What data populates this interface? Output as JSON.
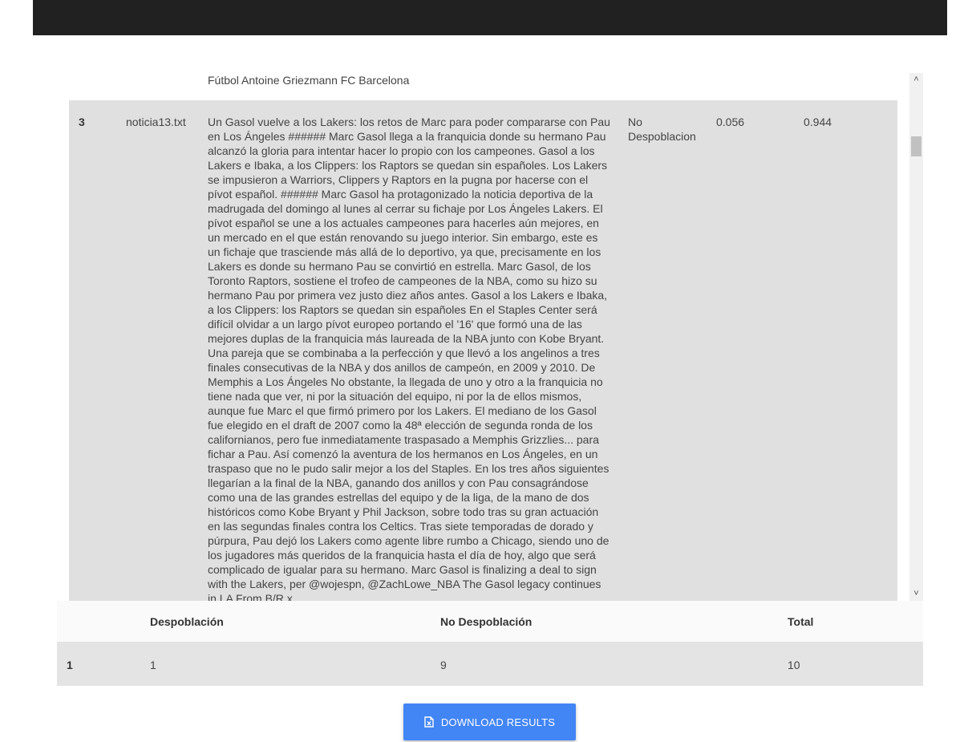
{
  "previous_row": {
    "text": "Fútbol Antoine Griezmann FC Barcelona"
  },
  "news_row": {
    "index": "3",
    "filename": "noticia13.txt",
    "body": "Un Gasol vuelve a los Lakers: los retos de Marc para poder compararse con Pau en Los Ángeles ###### Marc Gasol llega a la franquicia donde su hermano Pau alcanzó la gloria para intentar hacer lo propio con los campeones. Gasol a los Lakers e Ibaka, a los Clippers: los Raptors se quedan sin españoles. Los Lakers se impusieron a Warriors, Clippers y Raptors en la pugna por hacerse con el pívot español. ###### Marc Gasol ha protagonizado la noticia deportiva de la madrugada del domingo al lunes al cerrar su fichaje por Los Ángeles Lakers. El pívot español se une a los actuales campeones para hacerles aún mejores, en un mercado en el que están renovando su juego interior. Sin embargo, este es un fichaje que trasciende más allá de lo deportivo, ya que, precisamente en los Lakers es donde su hermano Pau se convirtió en estrella. Marc Gasol, de los Toronto Raptors, sostiene el trofeo de campeones de la NBA, como su hizo su hermano Pau por primera vez justo diez años antes. Gasol a los Lakers e Ibaka, a los Clippers: los Raptors se quedan sin españoles En el Staples Center será difícil olvidar a un largo pívot europeo portando el '16' que formó una de las mejores duplas de la franquicia más laureada de la NBA junto con Kobe Bryant. Una pareja que se combinaba a la perfección y que llevó a los angelinos a tres finales consecutivas de la NBA y dos anillos de campeón, en 2009 y 2010. De Memphis a Los Ángeles No obstante, la llegada de uno y otro a la franquicia no tiene nada que ver, ni por la situación del equipo, ni por la de ellos mismos, aunque fue Marc el que firmó primero por los Lakers. El mediano de los Gasol fue elegido en el draft de 2007 como la 48ª elección de segunda ronda de los californianos, pero fue inmediatamente traspasado a Memphis Grizzlies... para fichar a Pau. Así comenzó la aventura de los hermanos en Los Ángeles, en un traspaso que no le pudo salir mejor a los del Staples. En los tres años siguientes llegarían a la final de la NBA, ganando dos anillos y con Pau consagrándose como una de las grandes estrellas del equipo y de la liga, de la mano de dos históricos como Kobe Bryant y Phil Jackson, sobre todo tras su gran actuación en las segundas finales contra los Celtics. Tras siete temporadas de dorado y púrpura, Pau dejó los Lakers como agente libre rumbo a Chicago, siendo uno de los jugadores más queridos de la franquicia hasta el día de hoy, algo que será complicado de igualar para su hermano. Marc Gasol is finalizing a deal to sign with the Lakers, per @wojespn, @ZachLowe_NBA The Gasol legacy continues in LA From B/R x",
    "label": "No Despoblacion",
    "prob_1": "0.056",
    "prob_2": "0.944"
  },
  "summary": {
    "headers": [
      "",
      "Despoblación",
      "No Despoblación",
      "Total"
    ],
    "rows": [
      [
        "1",
        "1",
        "9",
        "10"
      ]
    ]
  },
  "download": {
    "label": "DOWNLOAD RESULTS",
    "icon": "excel-file-icon"
  },
  "colors": {
    "topbar": "#212121",
    "row_highlight": "#e0e0e0",
    "button": "#4285f4"
  }
}
